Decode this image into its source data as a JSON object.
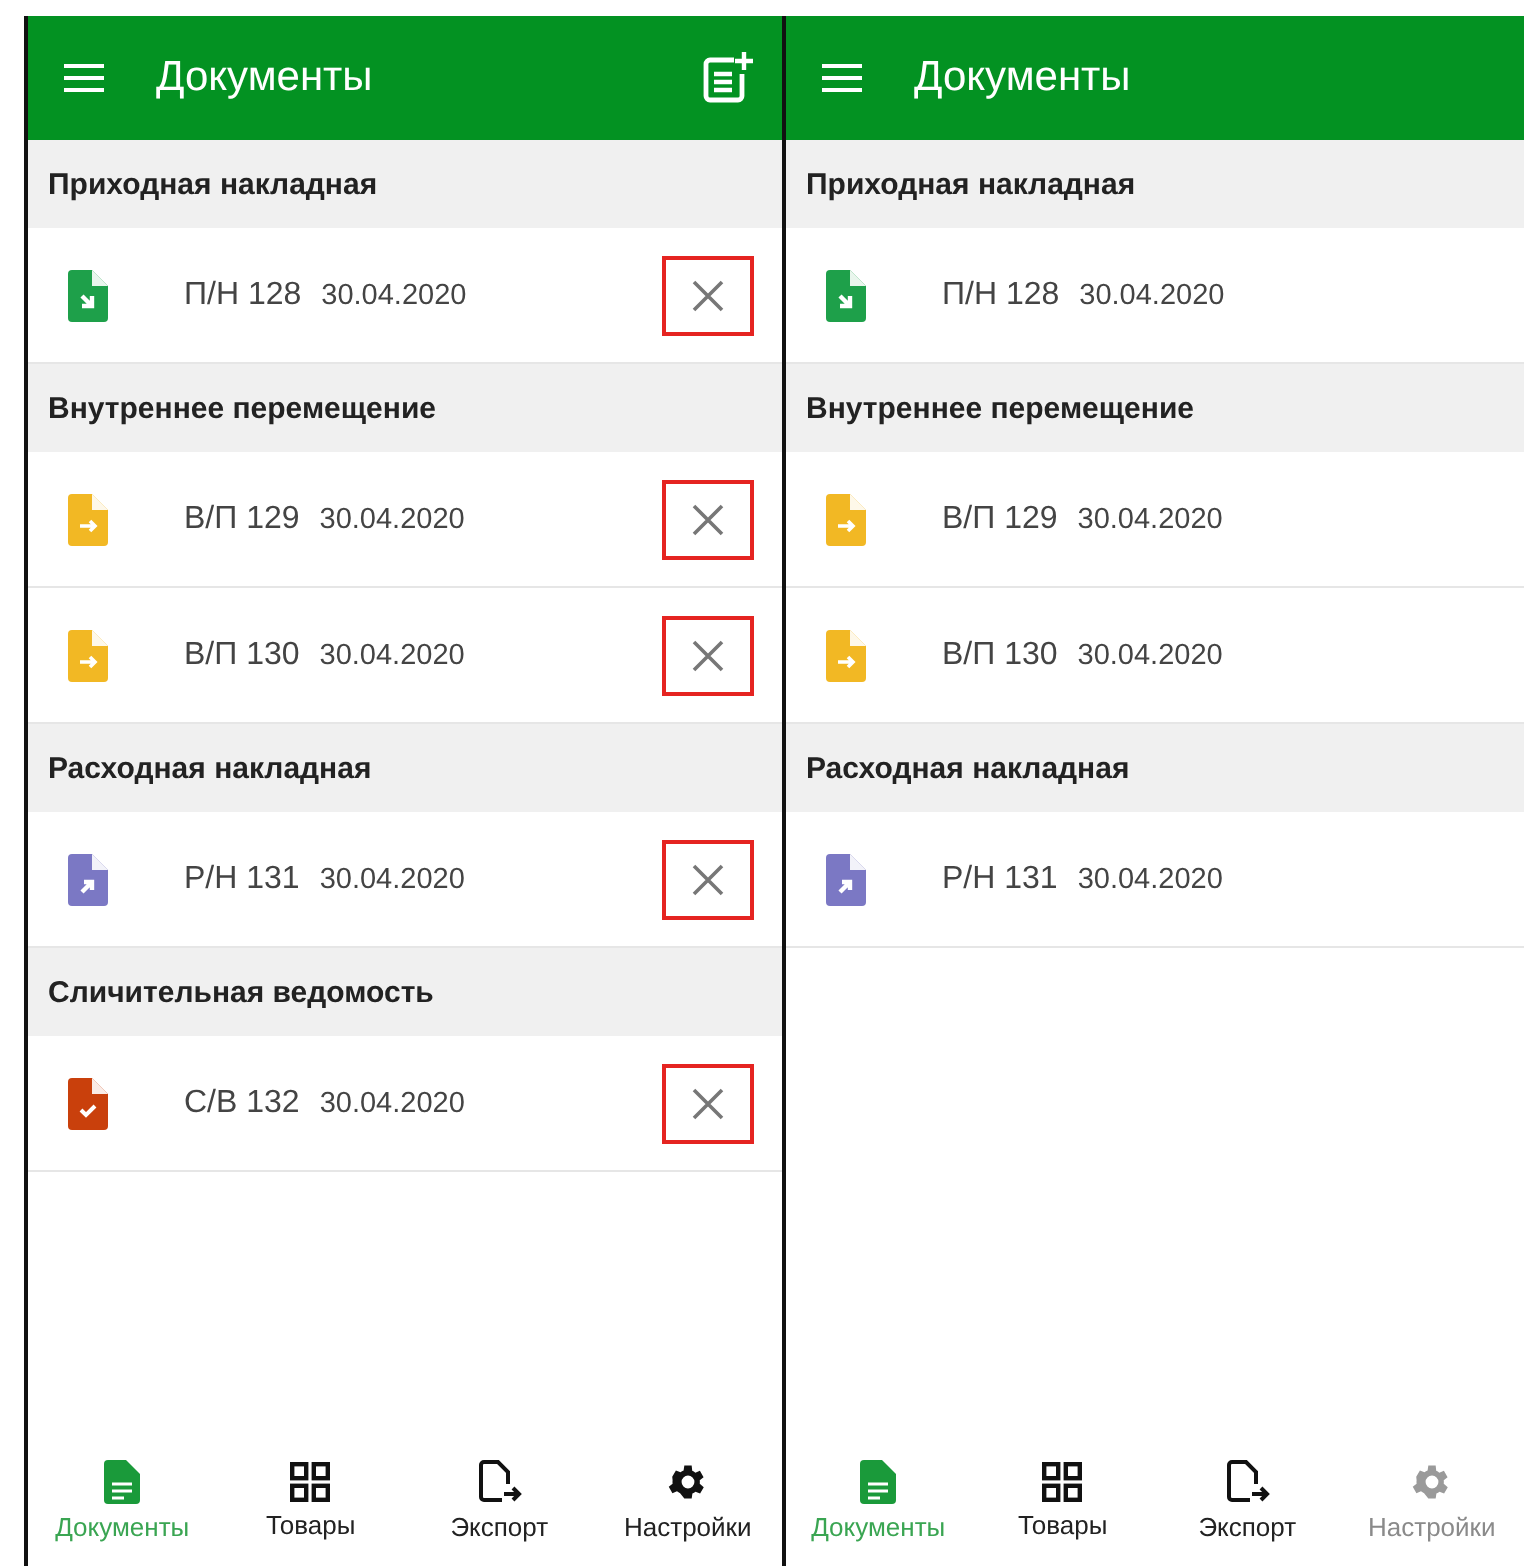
{
  "screens": [
    {
      "title": "Документы",
      "add_button": true,
      "sections": [
        {
          "title": "Приходная накладная",
          "documents": [
            {
              "kind": "incoming",
              "number": "П/Н 128",
              "date": "30.04.2020",
              "delete_button": true
            }
          ]
        },
        {
          "title": "Внутреннее перемещение",
          "documents": [
            {
              "kind": "transfer",
              "number": "В/П 129",
              "date": "30.04.2020",
              "delete_button": true
            },
            {
              "kind": "transfer",
              "number": "В/П 130",
              "date": "30.04.2020",
              "delete_button": true
            }
          ]
        },
        {
          "title": "Расходная накладная",
          "documents": [
            {
              "kind": "outgoing",
              "number": "Р/Н 131",
              "date": "30.04.2020",
              "delete_button": true
            }
          ]
        },
        {
          "title": "Сличительная ведомость",
          "documents": [
            {
              "kind": "check",
              "number": "С/В 132",
              "date": "30.04.2020",
              "delete_button": true
            }
          ]
        }
      ],
      "nav": [
        {
          "kind": "documents",
          "label": "Документы",
          "selected": true,
          "disabled": false
        },
        {
          "kind": "goods",
          "label": "Товары",
          "selected": false,
          "disabled": false
        },
        {
          "kind": "export",
          "label": "Экспорт",
          "selected": false,
          "disabled": false
        },
        {
          "kind": "settings",
          "label": "Настройки",
          "selected": false,
          "disabled": false
        }
      ]
    },
    {
      "title": "Документы",
      "add_button": false,
      "sections": [
        {
          "title": "Приходная накладная",
          "documents": [
            {
              "kind": "incoming",
              "number": "П/Н 128",
              "date": "30.04.2020",
              "delete_button": false
            }
          ]
        },
        {
          "title": "Внутреннее перемещение",
          "documents": [
            {
              "kind": "transfer",
              "number": "В/П 129",
              "date": "30.04.2020",
              "delete_button": false
            },
            {
              "kind": "transfer",
              "number": "В/П 130",
              "date": "30.04.2020",
              "delete_button": false
            }
          ]
        },
        {
          "title": "Расходная накладная",
          "documents": [
            {
              "kind": "outgoing",
              "number": "Р/Н 131",
              "date": "30.04.2020",
              "delete_button": false
            }
          ]
        }
      ],
      "nav": [
        {
          "kind": "documents",
          "label": "Документы",
          "selected": true,
          "disabled": false
        },
        {
          "kind": "goods",
          "label": "Товары",
          "selected": false,
          "disabled": false
        },
        {
          "kind": "export",
          "label": "Экспорт",
          "selected": false,
          "disabled": false
        },
        {
          "kind": "settings",
          "label": "Настройки",
          "selected": false,
          "disabled": true
        }
      ]
    }
  ]
}
